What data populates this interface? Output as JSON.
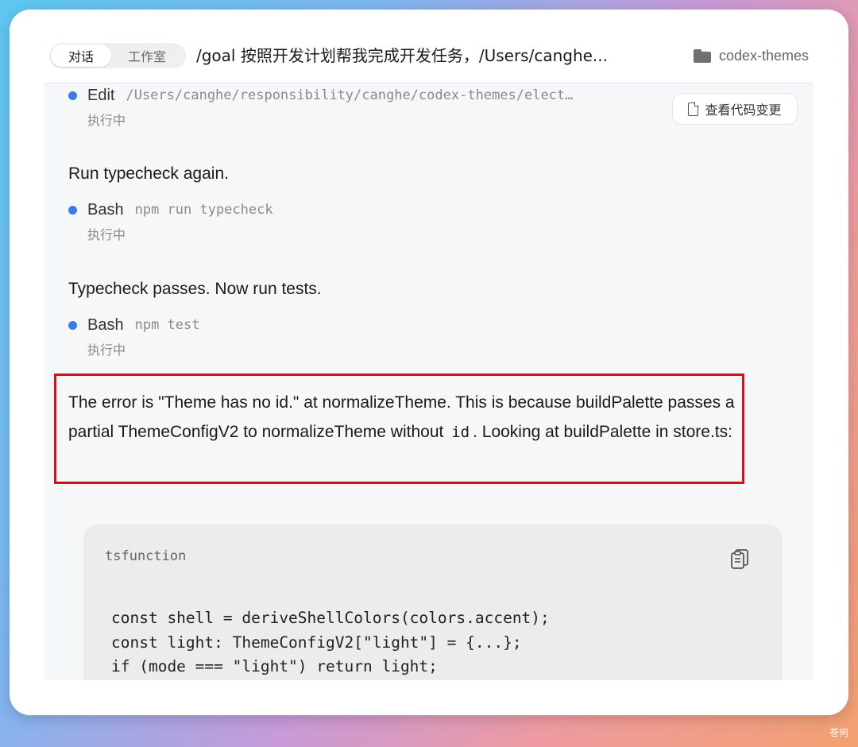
{
  "header": {
    "tabs": [
      {
        "label": "对话",
        "active": true
      },
      {
        "label": "工作室",
        "active": false
      }
    ],
    "title": "/goal 按照开发计划帮我完成开发任务，/Users/canghe...",
    "project": "codex-themes",
    "project_icon": "folder-icon"
  },
  "view_changes_label": "查看代码变更",
  "steps": [
    {
      "tool": "Edit",
      "arg": "/Users/canghe/responsibility/canghe/codex-themes/elect…",
      "status": "执行中"
    },
    {
      "message": "Run typecheck again."
    },
    {
      "tool": "Bash",
      "arg": "npm run typecheck",
      "status": "执行中"
    },
    {
      "message": "Typecheck passes. Now run tests."
    },
    {
      "tool": "Bash",
      "arg": "npm test",
      "status": "执行中"
    }
  ],
  "error_message": {
    "part1": "The error is \"Theme has no id.\" at normalizeTheme. This is because buildPalette passes a partial ThemeConfigV2 to normalizeTheme without",
    "code": "id",
    "part2": ". Looking at buildPalette in store.ts:"
  },
  "code_block": {
    "language": "tsfunction",
    "lines": [
      "const shell = deriveShellColors(colors.accent);",
      "const light: ThemeConfigV2[\"light\"] = {...};",
      "if (mode === \"light\") return light;"
    ]
  },
  "colors": {
    "accent_dot": "#3b7de8",
    "highlight_border": "#d0121b"
  },
  "watermark": "苍何"
}
